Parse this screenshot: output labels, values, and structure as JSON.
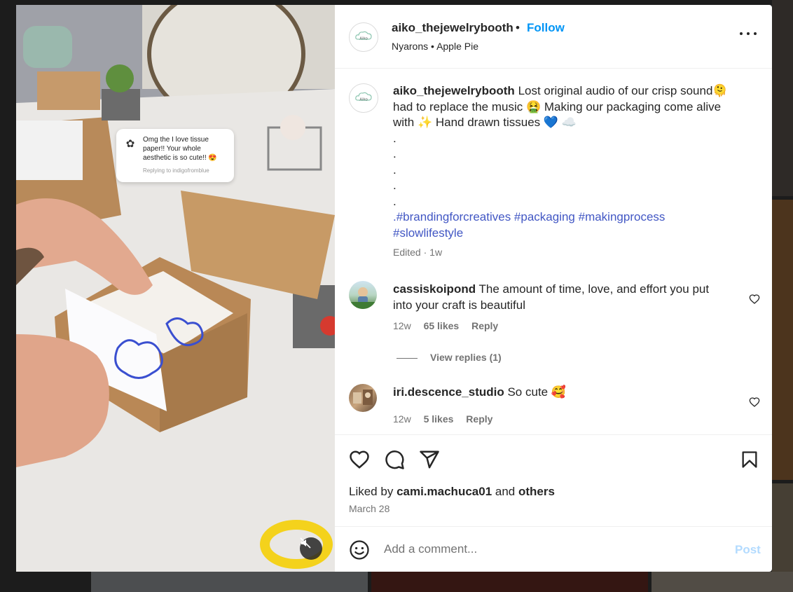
{
  "post": {
    "username": "aiko_thejewelrybooth",
    "separator": "•",
    "follow_label": "Follow",
    "audio_artist": "Nyarons",
    "audio_song": "Apple Pie",
    "logo_text": "Aiko"
  },
  "story_overlay": {
    "text": "Omg the I love tissue paper!! Your whole aesthetic is so cute!! 😍",
    "reply_to": "Replying to indigofromblue"
  },
  "caption": {
    "username": "aiko_thejewelrybooth",
    "text": "Lost original audio of our crisp sound🫠 had to replace the music 🤮 Making our packaging come alive with ✨  Hand drawn tissues 💙 ☁️",
    "dots": [
      ".",
      ".",
      ".",
      ".",
      "."
    ],
    "hashtags_line1": ".#brandingforcreatives #packaging #makingprocess",
    "hashtags_line2": "#slowlifestyle",
    "edited": "Edited",
    "separator": "·",
    "age": "1w"
  },
  "comments": [
    {
      "username": "cassiskoipond",
      "text": "The amount of time, love, and effort you put into your craft is beautiful",
      "age": "12w",
      "likes": "65 likes",
      "reply_label": "Reply"
    },
    {
      "username": "iri.descence_studio",
      "text": "So cute 🥰",
      "age": "12w",
      "likes": "5 likes",
      "reply_label": "Reply"
    }
  ],
  "view_replies": "View replies (1)",
  "engagement": {
    "liked_by_prefix": "Liked by",
    "liked_by_user": "cami.machuca01",
    "liked_by_and": "and",
    "liked_by_others": "others",
    "date": "March 28"
  },
  "comment_box": {
    "placeholder": "Add a comment...",
    "post_label": "Post"
  },
  "colors": {
    "link_blue": "#0095f6",
    "hashtag_blue": "#4257c4",
    "muted_text": "#737373",
    "post_disabled": "#b3dbff"
  },
  "icons": [
    "heart-icon",
    "comment-icon",
    "share-icon",
    "bookmark-icon",
    "emoji-icon",
    "more-icon",
    "mute-icon"
  ]
}
